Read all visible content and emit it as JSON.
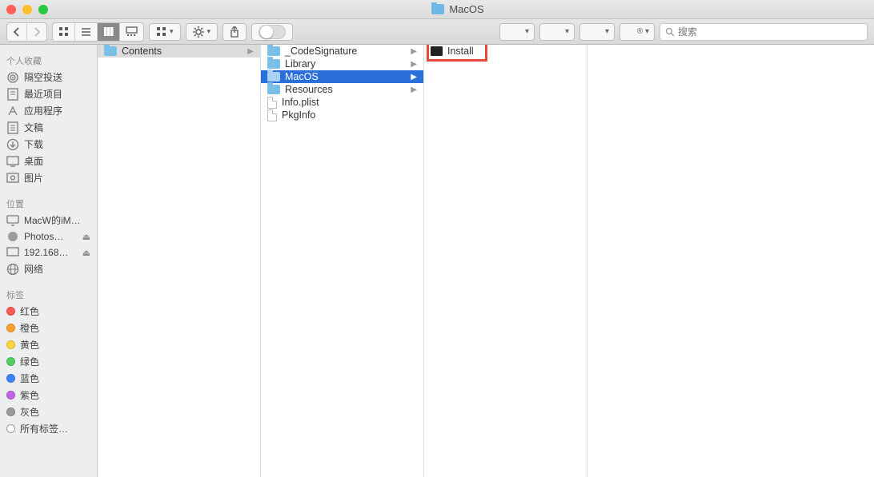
{
  "window": {
    "title": "MacOS",
    "traffic": {
      "close": "#ff5f57",
      "minimize": "#ffbd2e",
      "zoom": "#28c940"
    }
  },
  "toolbar": {
    "search_placeholder": "搜索"
  },
  "sidebar": {
    "favorites_header": "个人收藏",
    "favorites": [
      {
        "label": "隔空投送",
        "icon": "airdrop-icon"
      },
      {
        "label": "最近项目",
        "icon": "recents-icon"
      },
      {
        "label": "应用程序",
        "icon": "applications-icon"
      },
      {
        "label": "文稿",
        "icon": "documents-icon"
      },
      {
        "label": "下载",
        "icon": "downloads-icon"
      },
      {
        "label": "桌面",
        "icon": "desktop-icon"
      },
      {
        "label": "图片",
        "icon": "pictures-icon"
      }
    ],
    "locations_header": "位置",
    "locations": [
      {
        "label": "MacW的iM…",
        "icon": "imac-icon",
        "eject": false
      },
      {
        "label": "Photos…",
        "icon": "disk-icon",
        "eject": true
      },
      {
        "label": "192.168…",
        "icon": "server-icon",
        "eject": true
      },
      {
        "label": "网络",
        "icon": "network-icon",
        "eject": false
      }
    ],
    "tags_header": "标签",
    "tags": [
      {
        "label": "红色",
        "color": "#ff5b55"
      },
      {
        "label": "橙色",
        "color": "#ff9e2f"
      },
      {
        "label": "黄色",
        "color": "#ffd53e"
      },
      {
        "label": "绿色",
        "color": "#4ed063"
      },
      {
        "label": "蓝色",
        "color": "#3b84ff"
      },
      {
        "label": "紫色",
        "color": "#c165e6"
      },
      {
        "label": "灰色",
        "color": "#9a9a9a"
      },
      {
        "label": "所有标签…",
        "color": null
      }
    ]
  },
  "columns": {
    "col1": [
      {
        "name": "Contents",
        "kind": "folder",
        "has_children": true,
        "selected": "gray"
      }
    ],
    "col2": [
      {
        "name": "_CodeSignature",
        "kind": "folder",
        "has_children": true,
        "selected": null
      },
      {
        "name": "Library",
        "kind": "folder",
        "has_children": true,
        "selected": null
      },
      {
        "name": "MacOS",
        "kind": "folder",
        "has_children": true,
        "selected": "blue"
      },
      {
        "name": "Resources",
        "kind": "folder",
        "has_children": true,
        "selected": null
      },
      {
        "name": "Info.plist",
        "kind": "file",
        "has_children": false,
        "selected": null
      },
      {
        "name": "PkgInfo",
        "kind": "file",
        "has_children": false,
        "selected": null
      }
    ],
    "col3": [
      {
        "name": "Install",
        "kind": "exec",
        "has_children": false,
        "selected": null,
        "highlighted": true
      }
    ]
  }
}
